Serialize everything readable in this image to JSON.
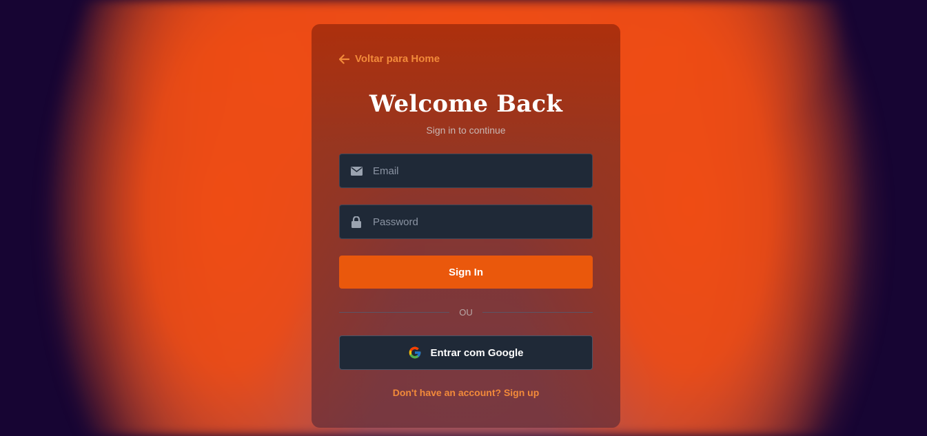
{
  "card": {
    "back_link": "Voltar para Home",
    "title": "Welcome Back",
    "subtitle": "Sign in to continue"
  },
  "form": {
    "email": {
      "placeholder": "Email",
      "value": "",
      "icon": "envelope-icon"
    },
    "password": {
      "placeholder": "Password",
      "value": "",
      "icon": "lock-icon"
    },
    "submit_label": "Sign In",
    "divider_text": "OU",
    "google_label": "Entrar com Google",
    "signup_text": "Don't have an account? Sign up"
  },
  "colors": {
    "accent": "#ea580c",
    "link": "#f28a3a",
    "input_bg": "#1f2937",
    "page_bg": "#170533",
    "glow": "#ef4c14"
  }
}
